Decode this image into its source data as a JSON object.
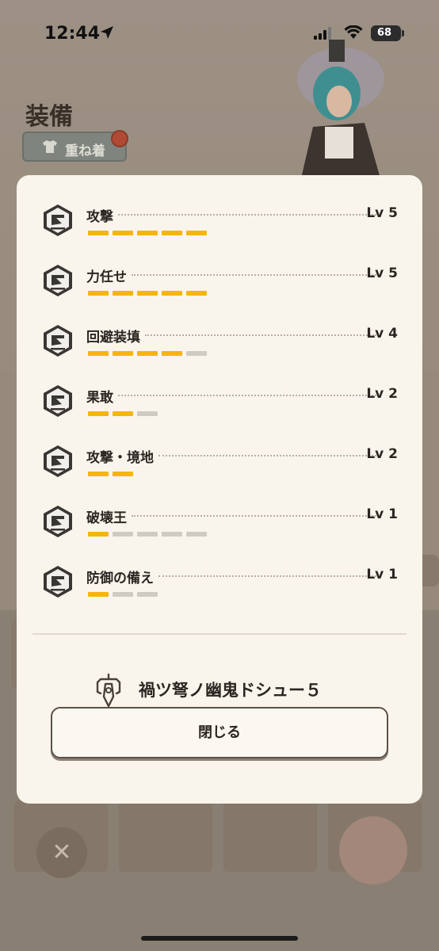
{
  "status_bar": {
    "time": "12:44",
    "battery": "68"
  },
  "page": {
    "title": "装備",
    "layering_button": "重ね着"
  },
  "modal": {
    "skills": [
      {
        "name": "攻撃",
        "level": "Lv 5",
        "value": 5,
        "max": 5
      },
      {
        "name": "力任せ",
        "level": "Lv 5",
        "value": 5,
        "max": 5
      },
      {
        "name": "回避装填",
        "level": "Lv 4",
        "value": 4,
        "max": 5
      },
      {
        "name": "果敢",
        "level": "Lv 2",
        "value": 2,
        "max": 3
      },
      {
        "name": "攻撃・境地",
        "level": "Lv 2",
        "value": 2,
        "max": 2
      },
      {
        "name": "破壊王",
        "level": "Lv 1",
        "value": 1,
        "max": 5
      },
      {
        "name": "防御の備え",
        "level": "Lv 1",
        "value": 1,
        "max": 3
      }
    ],
    "weapon_name": "禍ツ弩ノ幽鬼ドシュー５",
    "close_label": "閉じる"
  },
  "colors": {
    "filled": "#f5b50e",
    "empty": "#cfcac4"
  },
  "icons": {
    "skill_badge": "skill-badge-icon",
    "weapon": "bowgun-icon",
    "close": "x-icon"
  }
}
